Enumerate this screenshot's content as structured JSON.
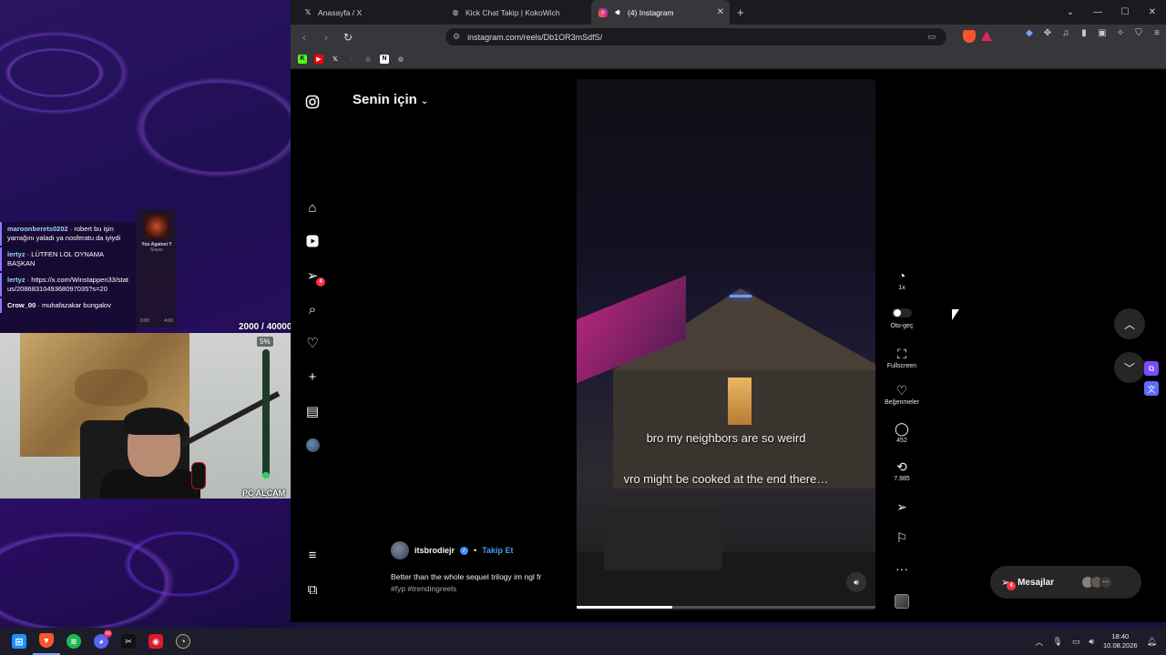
{
  "stream": {
    "chat": [
      {
        "user": "maroonberets0202",
        "text": "robert bu işin yarrağını yaladı ya nosferatu da iyiydi"
      },
      {
        "user": "lertyz",
        "text": "LÜTFEN LOL OYNAMA BAŞKAN"
      },
      {
        "user": "lertyz",
        "text": "https://x.com/Winstappen33/status/2086831049368097035?s=20"
      },
      {
        "user": "Crow_00",
        "text": "muhafazakar bungalov"
      }
    ],
    "song": {
      "title": "You Against Y",
      "artist": "Slayer",
      "time_start": "0:00",
      "time_end": "4:00"
    },
    "sub_goal": "2000 / 40000",
    "meter_pct_label": "5%",
    "meter_level": 0.05,
    "cam_label": "PC ALCAM"
  },
  "browser": {
    "tabs": [
      {
        "title": "Anasayfa / X",
        "icon": "x-icon"
      },
      {
        "title": "Kick Chat Takip | KokoWich",
        "icon": "globe-icon"
      },
      {
        "title": "(4) Instagram",
        "icon": "instagram-icon",
        "active": true
      }
    ],
    "url": "instagram.com/reels/Db1OR3mSdfS/"
  },
  "instagram": {
    "feed_title": "Senin için",
    "sidebar_badge": "4",
    "reel": {
      "caption_line1": "bro my neighbors are so weird",
      "caption_line2": "vro might be cooked at the end there…",
      "progress": 0.32,
      "username": "itsbrodiejr",
      "follow_label": "Takip Et",
      "caption": "Better than the whole sequel trilogy im ngl fr",
      "tags": "#fyp #trendingreels"
    },
    "actions": {
      "speed": "1x",
      "autoplay": "Oto-geç",
      "fullscreen": "Fullscreen",
      "likes": "Beğenmeler",
      "comments": "452",
      "reposts": "7.985"
    },
    "messages_label": "Mesajlar",
    "messages_badge": "4"
  },
  "taskbar": {
    "discord_badge": "99",
    "time": "18:40",
    "date": "10.08.2026"
  },
  "colors": {
    "accent": "#3897f0",
    "badge": "#ff3040",
    "brave": "#fb542b"
  }
}
